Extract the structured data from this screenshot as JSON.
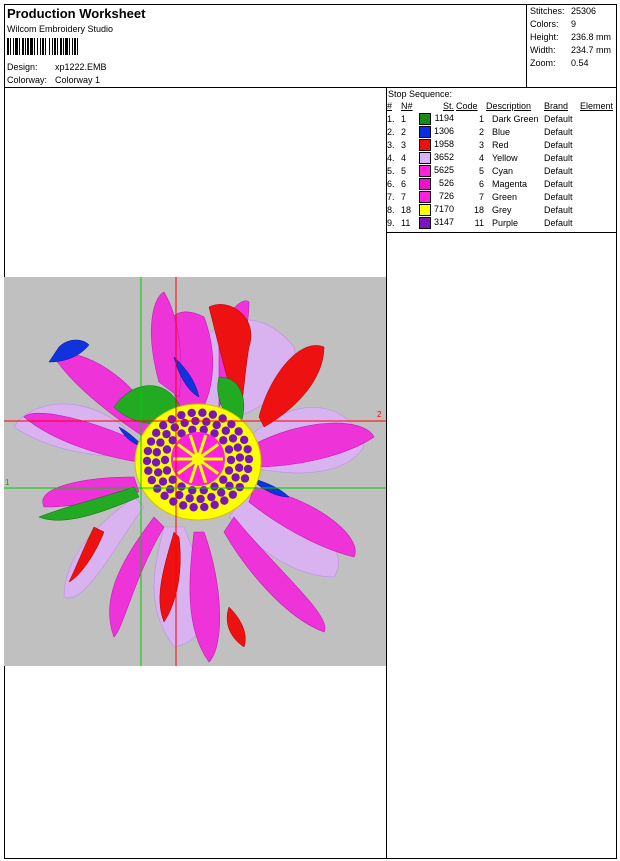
{
  "header": {
    "title": "Production Worksheet",
    "software": "Wilcom Embroidery Studio",
    "design_label": "Design:",
    "design_value": "xp1222.EMB",
    "colorway_label": "Colorway:",
    "colorway_value": "Colorway 1"
  },
  "stats": [
    {
      "label": "Stitches:",
      "value": "25306"
    },
    {
      "label": "Colors:",
      "value": "9"
    },
    {
      "label": "Height:",
      "value": "236.8 mm"
    },
    {
      "label": "Width:",
      "value": "234.7 mm"
    },
    {
      "label": "Zoom:",
      "value": "0.54"
    }
  ],
  "stop_sequence": {
    "title": "Stop Sequence:",
    "columns": [
      "#",
      "N#",
      "St.",
      "Code",
      "Description",
      "Brand",
      "Element"
    ],
    "rows": [
      {
        "num": "1.",
        "n": "1",
        "color": "#1a8a1a",
        "st": "1194",
        "code": "1",
        "desc": "Dark Green",
        "brand": "Default"
      },
      {
        "num": "2.",
        "n": "2",
        "color": "#0a2ee6",
        "st": "1306",
        "code": "2",
        "desc": "Blue",
        "brand": "Default"
      },
      {
        "num": "3.",
        "n": "3",
        "color": "#ee1111",
        "st": "1958",
        "code": "3",
        "desc": "Red",
        "brand": "Default"
      },
      {
        "num": "4.",
        "n": "4",
        "color": "#d6b4f4",
        "st": "3652",
        "code": "4",
        "desc": "Yellow",
        "brand": "Default"
      },
      {
        "num": "5.",
        "n": "5",
        "color": "#ff22dd",
        "st": "5625",
        "code": "5",
        "desc": "Cyan",
        "brand": "Default"
      },
      {
        "num": "6.",
        "n": "6",
        "color": "#ee11cc",
        "st": "526",
        "code": "6",
        "desc": "Magenta",
        "brand": "Default"
      },
      {
        "num": "7.",
        "n": "7",
        "color": "#ff22dd",
        "st": "726",
        "code": "7",
        "desc": "Green",
        "brand": "Default"
      },
      {
        "num": "8.",
        "n": "18",
        "color": "#ffff00",
        "st": "7170",
        "code": "18",
        "desc": "Grey",
        "brand": "Default"
      },
      {
        "num": "9.",
        "n": "11",
        "color": "#7a16b8",
        "st": "3147",
        "code": "11",
        "desc": "Purple",
        "brand": "Default"
      }
    ]
  },
  "design_area": {
    "background": "#c0c0c0",
    "marker_1": "1",
    "marker_2": "2"
  }
}
